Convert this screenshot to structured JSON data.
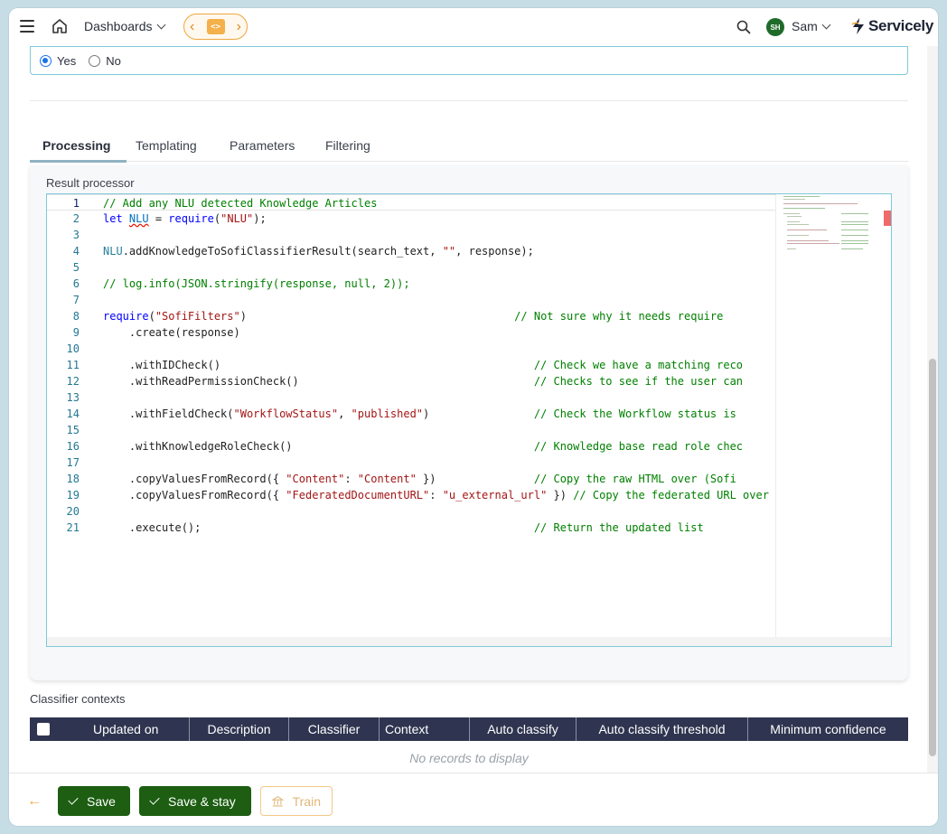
{
  "header": {
    "dashboards_label": "Dashboards",
    "user_initials": "SH",
    "user_name": "Sam",
    "logo_text": "Servicely"
  },
  "radio": {
    "options": [
      {
        "label": "Yes",
        "selected": true
      },
      {
        "label": "No",
        "selected": false
      }
    ]
  },
  "tabs": [
    {
      "label": "Processing",
      "active": true
    },
    {
      "label": "Templating",
      "active": false
    },
    {
      "label": "Parameters",
      "active": false
    },
    {
      "label": "Filtering",
      "active": false
    }
  ],
  "panel": {
    "label": "Result processor"
  },
  "code": {
    "lines": [
      "1",
      "2",
      "3",
      "4",
      "5",
      "6",
      "7",
      "8",
      "9",
      "10",
      "11",
      "12",
      "13",
      "14",
      "15",
      "16",
      "17",
      "18",
      "19",
      "20",
      "21"
    ]
  },
  "classifier": {
    "label": "Classifier contexts",
    "columns": [
      "Updated on",
      "Description",
      "Classifier",
      "Context",
      "Auto classify",
      "Auto classify threshold",
      "Minimum confidence"
    ],
    "empty_text": "No records to display"
  },
  "toolbar": {
    "save_label": "Save",
    "save_stay_label": "Save & stay",
    "train_label": "Train"
  },
  "colors": {
    "primary_green": "#1d5e12",
    "accent_orange": "#f0a640",
    "grid_header": "#2f3550"
  }
}
